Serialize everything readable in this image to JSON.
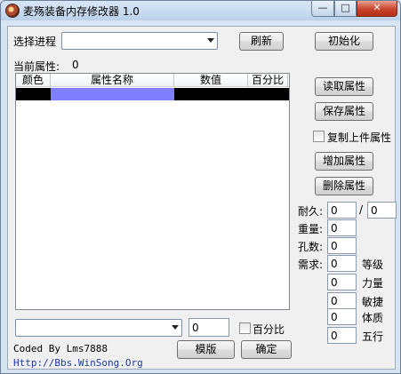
{
  "window": {
    "title": "麦殇装备内存修改器 1.0",
    "controls": {
      "minimize": "—",
      "maximize": "□",
      "close": "✕"
    }
  },
  "process": {
    "label": "选择进程",
    "selected": "",
    "refresh_label": "刷新",
    "init_label": "初始化"
  },
  "current_attr": {
    "label": "当前属性:",
    "count": "0"
  },
  "table": {
    "columns": [
      "颜色",
      "属性名称",
      "数值",
      "百分比"
    ],
    "rows": [
      {
        "color": "",
        "name": "",
        "value": "",
        "percent": ""
      }
    ],
    "row_name_color": "#8080ff"
  },
  "actions": {
    "read_label": "读取属性",
    "save_label": "保存属性",
    "copy_prev_label": "复制上件属性",
    "add_label": "增加属性",
    "delete_label": "删除属性"
  },
  "stats": {
    "durability_label": "耐久:",
    "durability_current": "0",
    "durability_separator": "/",
    "durability_max": "0",
    "weight_label": "重量:",
    "weight_value": "0",
    "holes_label": "孔数:",
    "holes_value": "0",
    "requirement_label": "需求:",
    "requirements": [
      {
        "value": "0",
        "label": "等级"
      },
      {
        "value": "0",
        "label": "力量"
      },
      {
        "value": "0",
        "label": "敏捷"
      },
      {
        "value": "0",
        "label": "体质"
      },
      {
        "value": "0",
        "label": "五行"
      }
    ]
  },
  "bottom": {
    "attr_select_value": "",
    "attr_value": "0",
    "percent_label": "百分比",
    "template_label": "模版",
    "confirm_label": "确定",
    "credit": "Coded By Lms7888",
    "url": "Http://Bbs.WinSong.Org"
  }
}
